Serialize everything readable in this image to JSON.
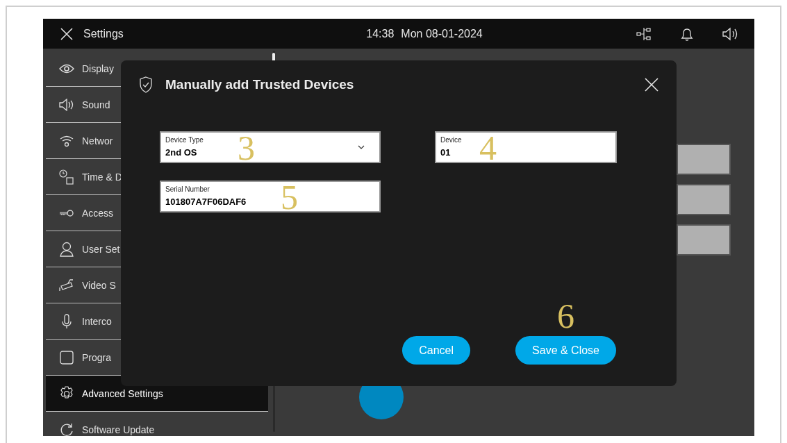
{
  "top_bar": {
    "title": "Settings",
    "time": "14:38",
    "date": "Mon 08-01-2024"
  },
  "sidebar": {
    "items": [
      {
        "label": "Display",
        "selected": false
      },
      {
        "label": "Sound",
        "selected": false
      },
      {
        "label": "Networ",
        "selected": false
      },
      {
        "label": "Time & D",
        "selected": false
      },
      {
        "label": "Access",
        "selected": false
      },
      {
        "label": "User Set",
        "selected": false
      },
      {
        "label": "Video S",
        "selected": false
      },
      {
        "label": "Interco",
        "selected": false
      },
      {
        "label": "Progra",
        "selected": false
      },
      {
        "label": "Advanced Settings",
        "selected": true
      },
      {
        "label": "Software Update",
        "selected": false
      }
    ]
  },
  "dialog": {
    "title": "Manually add Trusted Devices",
    "fields": [
      {
        "kind": "dropdown",
        "label": "Device Type",
        "value": "2nd OS",
        "callout": "3"
      },
      {
        "kind": "text",
        "label": "Device",
        "value": "01",
        "callout": "4"
      },
      {
        "kind": "text",
        "label": "Serial Number",
        "value": "101807A7F06DAF6",
        "callout": "5"
      }
    ],
    "buttons": [
      {
        "label": "Cancel"
      },
      {
        "label": "Save & Close",
        "callout": "6"
      }
    ]
  }
}
